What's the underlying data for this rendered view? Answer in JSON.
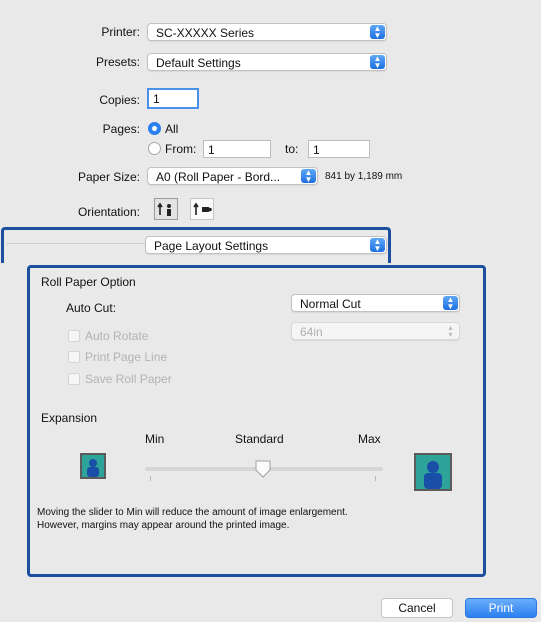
{
  "printer": {
    "label": "Printer:",
    "value": "SC-XXXXX Series"
  },
  "presets": {
    "label": "Presets:",
    "value": "Default Settings"
  },
  "copies": {
    "label": "Copies:",
    "value": "1"
  },
  "pages": {
    "label": "Pages:",
    "all": "All",
    "from_label": "From:",
    "from_value": "1",
    "to_label": "to:",
    "to_value": "1"
  },
  "paper_size": {
    "label": "Paper Size:",
    "value": "A0 (Roll Paper - Bord...",
    "dimensions": "841 by 1,189 mm"
  },
  "orientation": {
    "label": "Orientation:",
    "selected": "portrait"
  },
  "panel_menu": {
    "value": "Page Layout Settings"
  },
  "roll_paper": {
    "heading": "Roll Paper Option",
    "auto_cut_label": "Auto Cut:",
    "auto_cut_value": "Normal Cut",
    "auto_rotate": "Auto Rotate",
    "auto_rotate_value": "64in",
    "print_page_line": "Print Page Line",
    "save_roll_paper": "Save Roll Paper"
  },
  "expansion": {
    "heading": "Expansion",
    "min": "Min",
    "standard": "Standard",
    "max": "Max",
    "slider_level": 0.5,
    "note_line1": "Moving the slider to Min will reduce the amount of image enlargement.",
    "note_line2": "However, margins may appear around the printed image."
  },
  "buttons": {
    "cancel": "Cancel",
    "print": "Print"
  },
  "colors": {
    "accent": "#2a7ff0",
    "highlight_border": "#1c4f9e",
    "print_button": "#3d8ef5"
  }
}
